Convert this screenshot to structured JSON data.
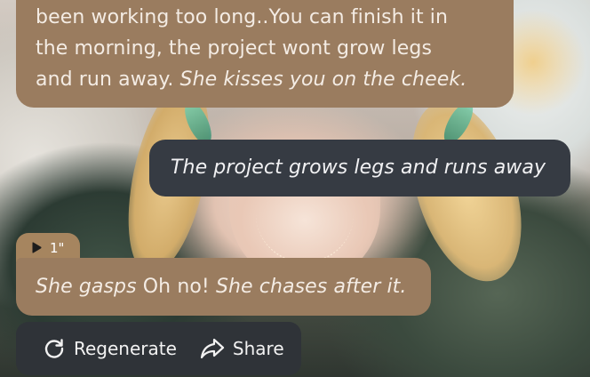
{
  "messages": [
    {
      "role": "ai",
      "line1": "been working too long..You can finish it in",
      "line2": "the morning, the project wont grow legs",
      "line3_plain": "and run away. ",
      "line3_action": "She kisses you on the cheek."
    },
    {
      "role": "user",
      "action": "The project grows legs and runs away"
    },
    {
      "role": "ai",
      "voice_label": "1\"",
      "action1": "She gasps",
      "plain": " Oh no! ",
      "action2": "She chases after it."
    }
  ],
  "actions": {
    "regenerate_label": "Regenerate",
    "share_label": "Share"
  },
  "icons": {
    "voice": "play-icon",
    "regenerate": "refresh-icon",
    "share": "share-icon"
  },
  "colors": {
    "ai_bubble": "#9a7c5f",
    "user_bubble": "#363b43",
    "action_bar": "#2f3338",
    "text": "#f4ece4"
  }
}
